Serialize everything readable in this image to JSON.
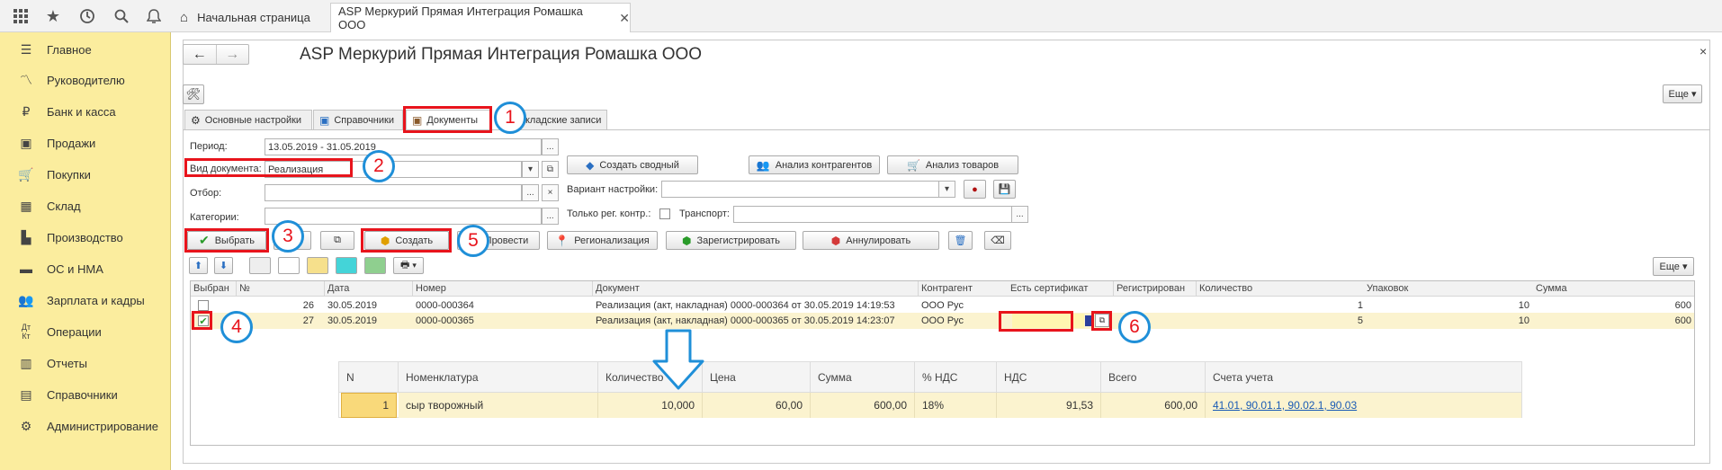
{
  "topbar": {
    "home_tab": "Начальная страница",
    "active_tab": "ASP Меркурий Прямая Интеграция Ромашка ООО",
    "close_tab": "✕"
  },
  "sidebar": {
    "items": [
      {
        "label": "Главное",
        "icon": "menu-lines-icon"
      },
      {
        "label": "Руководителю",
        "icon": "chart-line-icon"
      },
      {
        "label": "Банк и касса",
        "icon": "ruble-coin-icon"
      },
      {
        "label": "Продажи",
        "icon": "briefcase-icon"
      },
      {
        "label": "Покупки",
        "icon": "cart-icon"
      },
      {
        "label": "Склад",
        "icon": "warehouse-icon"
      },
      {
        "label": "Производство",
        "icon": "factory-icon"
      },
      {
        "label": "ОС и НМА",
        "icon": "truck-icon"
      },
      {
        "label": "Зарплата и кадры",
        "icon": "people-icon"
      },
      {
        "label": "Операции",
        "icon": "debit-credit-icon"
      },
      {
        "label": "Отчеты",
        "icon": "bar-chart-icon"
      },
      {
        "label": "Справочники",
        "icon": "book-icon"
      },
      {
        "label": "Администрирование",
        "icon": "gear-icon"
      }
    ]
  },
  "form": {
    "title": "ASP Меркурий Прямая Интеграция Ромашка ООО",
    "more": "Еще ▾",
    "close": "×"
  },
  "tabs": [
    {
      "label": "Основные настройки"
    },
    {
      "label": "Справочники"
    },
    {
      "label": "Документы"
    },
    {
      "label": "кладские записи"
    }
  ],
  "filters": {
    "period_label": "Период:",
    "period_value": "13.05.2019 - 31.05.2019",
    "doc_type_label": "Вид документа:",
    "doc_type_value": "Реализация",
    "filter_label": "Отбор:",
    "categories_label": "Категории:",
    "variant_label": "Вариант настройки:",
    "only_reg_label": "Только рег. контр.:",
    "transport_label": "Транспорт:"
  },
  "buttons": {
    "create_summary": "Создать сводный",
    "analyze_contractors": "Анализ контрагентов",
    "analyze_goods": "Анализ товаров",
    "select": "Выбрать",
    "create": "Создать",
    "post": "Провести",
    "regionalize": "Регионализация",
    "register": "Зарегистрировать",
    "cancel": "Аннулировать",
    "more": "Еще ▾"
  },
  "table": {
    "headers": [
      "Выбран",
      "№",
      "Дата",
      "Номер",
      "Документ",
      "Контрагент",
      "Есть сертификат",
      "Регистрирован",
      "Количество",
      "Упаковок",
      "Сумма"
    ],
    "rows": [
      {
        "num": "26",
        "date": "30.05.2019",
        "number": "0000-000364",
        "document": "Реализация (акт, накладная) 0000-000364 от 30.05.2019 14:19:53",
        "contractor": "ООО Рус",
        "qty": "1",
        "packs": "10",
        "sum": "600",
        "checked": false
      },
      {
        "num": "27",
        "date": "30.05.2019",
        "number": "0000-000365",
        "document": "Реализация (акт, накладная) 0000-000365 от 30.05.2019 14:23:07",
        "contractor": "ООО Рус",
        "qty": "5",
        "packs": "10",
        "sum": "600",
        "checked": true
      }
    ]
  },
  "subtable": {
    "headers": [
      "N",
      "Номенклатура",
      "Количество",
      "Цена",
      "Сумма",
      "% НДС",
      "НДС",
      "Всего",
      "Счета учета"
    ],
    "row": {
      "n": "1",
      "item": "сыр творожный",
      "qty": "10,000",
      "price": "60,00",
      "sum": "600,00",
      "vat_rate": "18%",
      "vat": "91,53",
      "total": "600,00",
      "accounts": "41.01, 90.01.1, 90.02.1, 90.03"
    }
  },
  "annotations": [
    "1",
    "2",
    "3",
    "4",
    "5",
    "6"
  ],
  "colors": {
    "sidebar": "#fbed9e",
    "callout_red": "#e8141c",
    "circle_blue": "#1f8fd8",
    "selected_row": "#fbf3cf",
    "link": "#1a5bb5"
  }
}
